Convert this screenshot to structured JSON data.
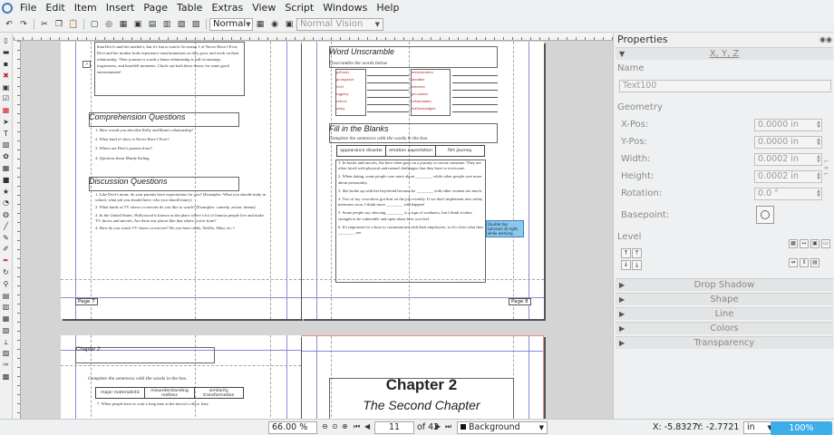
{
  "menubar": {
    "items": [
      "File",
      "Edit",
      "Item",
      "Insert",
      "Page",
      "Table",
      "Extras",
      "View",
      "Script",
      "Windows",
      "Help"
    ]
  },
  "toolbar": {
    "mode_select": "Normal",
    "vision_select": "Normal Vision"
  },
  "page1": {
    "intro_text": "than Devi's and her mother's, but it's fun to watch. In season 1 of Never Have I Ever, Devi and her mother both experience transformations as they grow and work on their relationship. Their journey is worth a home relationship is full of missteps, forgiveness, and heartfelt moments. Check out both these shows for some good entertainment!",
    "comprehension_title": "Comprehension Questions",
    "comprehension_items": [
      "1.  How would you describe Kelly and Ryan's relationship?",
      "2.  What kind of show is Never Have I Ever?",
      "3.  Where are Devi's parents from?",
      "4.  Question about Mindy Kaling"
    ],
    "discussion_title": "Discussion Questions",
    "discussion_items": [
      "1.  Like Devi's mom, do your parents have expectations for you? (Examples: What you should study in school, what job you should have, who you should marry)",
      "2.  What kinds of TV shows or movies do you like to watch? (Examples: comedy, action, drama)",
      "3.  In the United States, Hollywood is known as the place where a lot of famous people live and make TV shows and movies. Are there any places like that where you're from?",
      "4.  How do you watch TV shows or movies? Do you have cable, Netflix, Hulu, etc.?"
    ],
    "page_label": "Page 7"
  },
  "page2": {
    "unscramble_title": "Word Unscramble",
    "unscramble_sub": "Unscramble the words below",
    "words_left": [
      "pelitraiy",
      "proaspeace",
      "fresl",
      "isqpeuy",
      "eelorsr",
      "aenyj"
    ],
    "words_right": [
      "aerstimeation",
      "iaesdme",
      "teneemo",
      "pecsraanit",
      "eelantumbui",
      "vialtoretaulgeic"
    ],
    "fill_title": "Fill in the Blanks",
    "fill_sub": "Complete the sentences with the words in the box.",
    "fill_box": [
      "appearance disaster",
      "emotion expectation",
      "flirt journey"
    ],
    "fill_items": [
      "1.  In books and movies, the hero often goes on a journey to rescue someone. They are often faced with physical and mental challenges that they have to overcome.",
      "2.  When dating, some people care more about ________ while other people care more about personality.",
      "3.  She broke up with her boyfriend because he ________ with other women too much.",
      "4.  Two of my coworkers got hurt on the job recently. If we don't implement new safety measures soon, I think more ________ will happen!",
      "5.  Some people say showing ________ is a sign of weakness, but I think it takes strength to be vulnerable and open about how you feel.",
      "6.  It's important for a boss to communicate with their employees, so it's clear what they ________ are."
    ],
    "note_text": "Double tap (phrase) at right, while working",
    "page_label": "Page 8"
  },
  "page3": {
    "heading": "Chapter 2",
    "sub": "Complete the sentences with the words in the box.",
    "box": [
      "major materialistic",
      "misunderstanding restless",
      "similarity transformation"
    ],
    "first_item": "7. When people have to wait a long time at the doctor's office, they"
  },
  "page4": {
    "chapter_title": "Chapter 2",
    "chapter_subtitle": "The Second Chapter"
  },
  "properties": {
    "title": "Properties",
    "xyz_label": "X, Y, Z",
    "name_label": "Name",
    "name_value": "Text100",
    "geometry_label": "Geometry",
    "xpos_label": "X-Pos:",
    "xpos_value": "0.0000 in",
    "ypos_label": "Y-Pos:",
    "ypos_value": "0.0000 in",
    "width_label": "Width:",
    "width_value": "0.0002 in",
    "height_label": "Height:",
    "height_value": "0.0002 in",
    "rotation_label": "Rotation:",
    "rotation_value": "0.0 °",
    "basepoint_label": "Basepoint:",
    "level_label": "Level",
    "sections": [
      "Drop Shadow",
      "Shape",
      "Line",
      "Colors",
      "Transparency"
    ]
  },
  "statusbar": {
    "zoom_value": "66.00 %",
    "page_current": "11",
    "page_total": "of 42",
    "layer": "Background",
    "x_readout": "X: -5.8327",
    "y_readout": "Y: -2.7721",
    "unit": "in",
    "zoom_button": "100%"
  }
}
